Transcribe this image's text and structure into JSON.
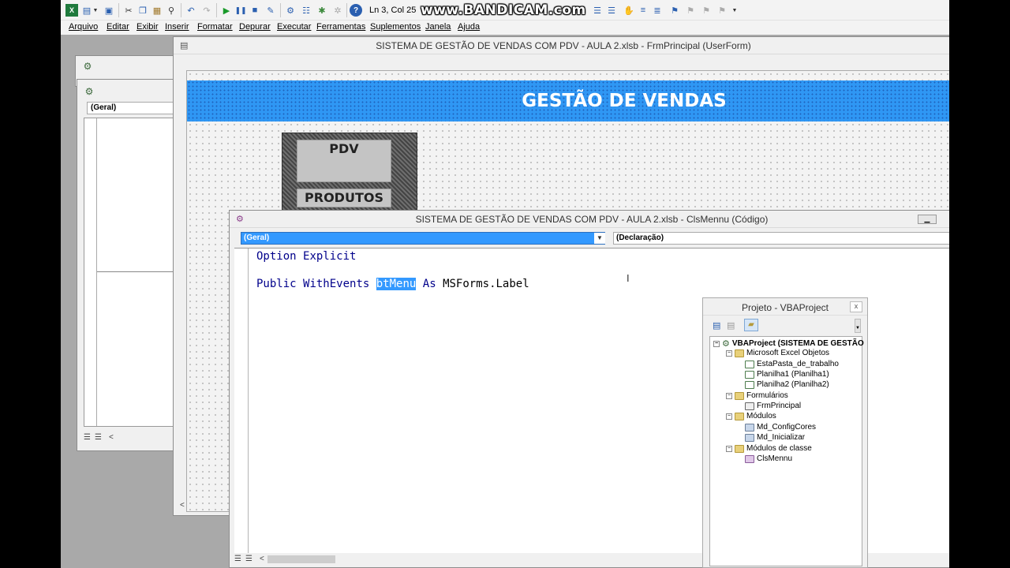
{
  "toolbar": {
    "position_text": "Ln 3, Col 25",
    "watermark": "www.BANDICAM.com"
  },
  "menu": [
    "Arquivo",
    "Editar",
    "Exibir",
    "Inserir",
    "Formatar",
    "Depurar",
    "Executar",
    "Ferramentas",
    "Suplementos",
    "Janela",
    "Ajuda"
  ],
  "left_window": {
    "combo": "(Geral)"
  },
  "userform": {
    "title": "SISTEMA DE GESTÃO DE VENDAS COM PDV - AULA 2.xlsb - FrmPrincipal (UserForm)",
    "banner_title": "GESTÃO DE VENDAS",
    "buttons": [
      "PDV",
      "PRODUTOS"
    ]
  },
  "code_window": {
    "title": "SISTEMA DE GESTÃO DE VENDAS COM PDV - AULA 2.xlsb - ClsMennu (Código)",
    "object_combo": "(Geral)",
    "proc_combo": "(Declaração)",
    "line1_kw1": "Option",
    "line1_kw2": "Explicit",
    "line2_kw1": "Public",
    "line2_kw2": "WithEvents",
    "line2_selected": "btMenu",
    "line2_kw3": "As",
    "line2_type": "MSForms.Label"
  },
  "project_explorer": {
    "title": "Projeto - VBAProject",
    "close": "x",
    "root": "VBAProject (SISTEMA DE GESTÃO",
    "folder_excel": "Microsoft Excel Objetos",
    "excel_items": [
      "EstaPasta_de_trabalho",
      "Planilha1 (Planilha1)",
      "Planilha2 (Planilha2)"
    ],
    "folder_forms": "Formulários",
    "form_items": [
      "FrmPrincipal"
    ],
    "folder_modules": "Módulos",
    "module_items": [
      "Md_ConfigCores",
      "Md_Inicializar"
    ],
    "folder_class": "Módulos de classe",
    "class_items": [
      "ClsMennu"
    ]
  },
  "colors": {
    "banner": "#2f97f4",
    "selection": "#3399ff",
    "keyword": "#00008b"
  }
}
